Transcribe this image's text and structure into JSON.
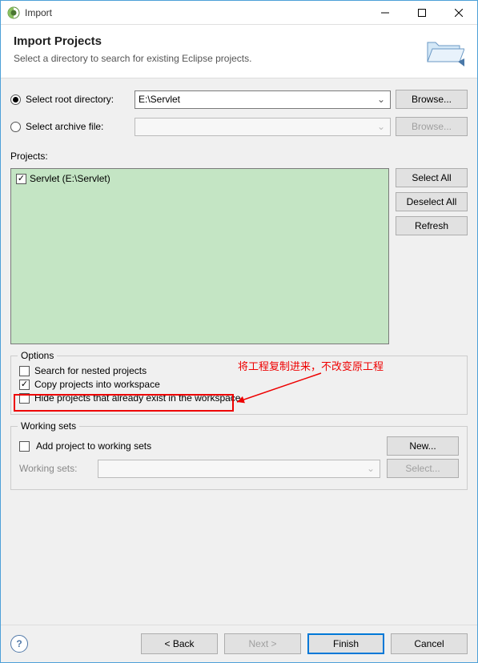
{
  "window": {
    "title": "Import"
  },
  "header": {
    "title": "Import Projects",
    "subtitle": "Select a directory to search for existing Eclipse projects."
  },
  "source": {
    "root_radio_label": "Select root directory:",
    "root_value": "E:\\Servlet",
    "archive_radio_label": "Select archive file:",
    "archive_value": "",
    "browse_label": "Browse..."
  },
  "projects": {
    "label": "Projects:",
    "items": [
      {
        "label": "Servlet (E:\\Servlet)",
        "checked": true
      }
    ],
    "select_all": "Select All",
    "deselect_all": "Deselect All",
    "refresh": "Refresh"
  },
  "options": {
    "legend": "Options",
    "search_nested": "Search for nested projects",
    "copy_into_ws": "Copy projects into workspace",
    "hide_existing": "Hide projects that already exist in the workspace"
  },
  "working_sets": {
    "legend": "Working sets",
    "add_label": "Add project to working sets",
    "new_btn": "New...",
    "ws_label": "Working sets:",
    "select_btn": "Select..."
  },
  "annotation": {
    "text": "将工程复制进来，不改变原工程"
  },
  "footer": {
    "back": "< Back",
    "next": "Next >",
    "finish": "Finish",
    "cancel": "Cancel"
  }
}
